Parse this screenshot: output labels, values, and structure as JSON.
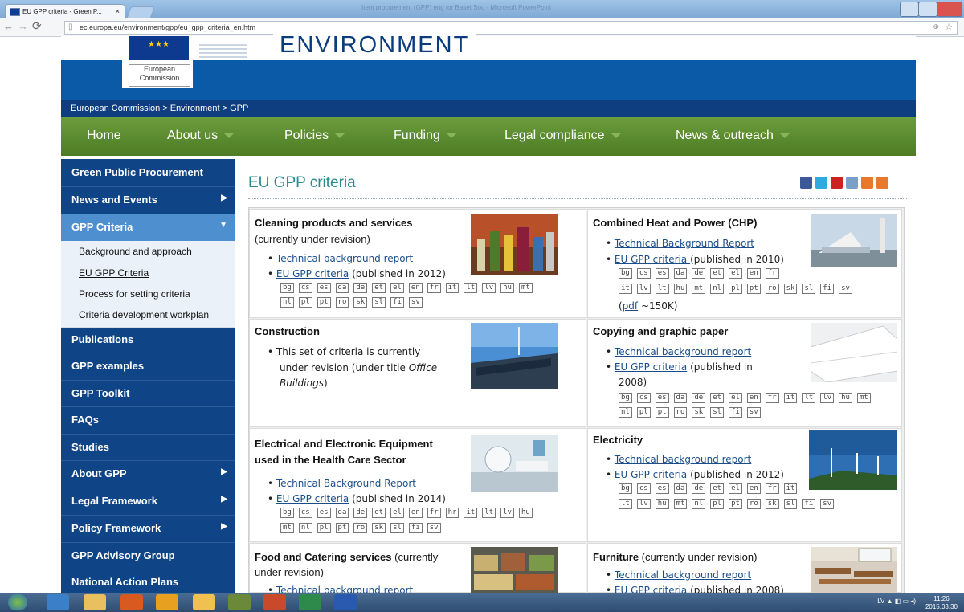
{
  "browser": {
    "tab_title": "EU GPP criteria - Green P...",
    "tab_close": "×",
    "window_title": "Item procurement (GPP) eng for Baset Sou - Microsoft PowerPoint",
    "url": "ec.europa.eu/environment/gpp/eu_gpp_criteria_en.htm"
  },
  "header": {
    "commission": "European Commission",
    "site_title": "ENVIRONMENT",
    "breadcrumb": "European Commission > Environment > GPP"
  },
  "menu": {
    "items": [
      "Home",
      "About us",
      "Policies",
      "Funding",
      "Legal compliance",
      "News & outreach"
    ]
  },
  "sidebar": {
    "items": [
      "Green Public Procurement",
      "News and Events",
      "GPP Criteria",
      "Background and approach",
      "EU GPP Criteria",
      "Process for setting criteria",
      "Criteria development workplan",
      "Publications",
      "GPP examples",
      "GPP Toolkit",
      "FAQs",
      "Studies",
      "About GPP",
      "Legal Framework",
      "Policy Framework",
      "GPP Advisory Group",
      "National Action Plans"
    ]
  },
  "content": {
    "title": "EU GPP criteria",
    "cells": {
      "cleaning": {
        "heading": "Cleaning products and services",
        "sub": "(currently under revision)",
        "link1": "Technical background report",
        "link2": "EU GPP criteria",
        "link2_tail": " (published in 2012)",
        "langs1": [
          "bg",
          "cs",
          "es",
          "da",
          "de",
          "et",
          "el",
          "en",
          "fr",
          "it",
          "lt",
          "lv",
          "hu",
          "mt"
        ],
        "langs2": [
          "nl",
          "pl",
          "pt",
          "ro",
          "sk",
          "sl",
          "fi",
          "sv"
        ]
      },
      "chp": {
        "heading": "Combined Heat and Power (CHP)",
        "link1": "Technical Background Report",
        "link2": "EU GPP criteria ",
        "link2_tail": "(published in 2010)",
        "langs1": [
          "bg",
          "cs",
          "es",
          "da",
          "de",
          "et",
          "el",
          "en",
          "fr"
        ],
        "langs2": [
          "it",
          "lv",
          "lt",
          "hu",
          "mt",
          "nl",
          "pl",
          "pt",
          "ro",
          "sk",
          "sl",
          "fi",
          "sv"
        ],
        "pdf": "pdf",
        "pdf_size": " ~150K)"
      },
      "construction": {
        "heading": "Construction",
        "line1": "This set of criteria is currently",
        "line2": "under revision (under title ",
        "line2_italic": "Office",
        "line3_italic": "Buildings",
        "line3": ")"
      },
      "copying": {
        "heading": "Copying and graphic paper",
        "link1": "Technical background report",
        "link2": "EU GPP criteria",
        "link2_tail": " (published in",
        "year": "2008)",
        "langs1": [
          "bg",
          "cs",
          "es",
          "da",
          "de",
          "et",
          "el",
          "en",
          "fr",
          "it",
          "lt",
          "lv",
          "hu",
          "mt"
        ],
        "langs2": [
          "nl",
          "pl",
          "pt",
          "ro",
          "sk",
          "sl",
          "fi",
          "sv"
        ]
      },
      "electrical": {
        "heading1": "Electrical and Electronic Equipment",
        "heading2": "used in the Health Care Sector",
        "link1": "Technical Background Report",
        "link2": "EU GPP criteria",
        "link2_tail": " (published in 2014)",
        "langs1": [
          "bg",
          "cs",
          "es",
          "da",
          "de",
          "et",
          "el",
          "en",
          "fr",
          "hr",
          "it",
          "lt",
          "lv",
          "hu"
        ],
        "langs2": [
          "mt",
          "nl",
          "pl",
          "pt",
          "ro",
          "sk",
          "sl",
          "fi",
          "sv"
        ]
      },
      "electricity": {
        "heading": "Electricity",
        "link1": "Technical background report",
        "link2": "EU GPP criteria",
        "link2_tail": " (published in 2012)",
        "langs1": [
          "bg",
          "cs",
          "es",
          "da",
          "de",
          "et",
          "el",
          "en",
          "fr",
          "it"
        ],
        "langs2": [
          "lt",
          "lv",
          "hu",
          "mt",
          "nl",
          "pl",
          "pt",
          "ro",
          "sk",
          "sl",
          "fi",
          "sv"
        ]
      },
      "food": {
        "heading": "Food and Catering services",
        "heading_tail": " (currently",
        "sub": "under revision)",
        "link1": "Technical background report"
      },
      "furniture": {
        "heading": "Furniture",
        "heading_tail": " (currently under revision)",
        "link1": "Technical background report",
        "link2": "EU GPP criteria",
        "link2_tail": " (published in 2008)"
      }
    }
  },
  "taskbar": {
    "lang": "LV",
    "time": "11:26",
    "date": "2015.03.30"
  }
}
